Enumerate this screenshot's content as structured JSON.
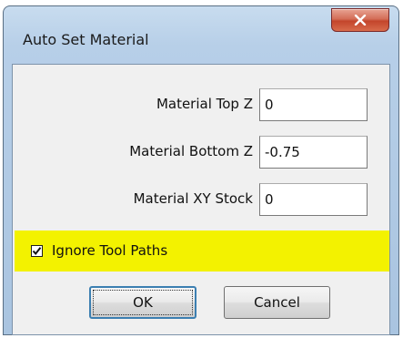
{
  "window": {
    "title": "Auto Set Material"
  },
  "fields": [
    {
      "label": "Material Top Z",
      "value": "0"
    },
    {
      "label": "Material Bottom Z",
      "value": "-0.75"
    },
    {
      "label": "Material XY Stock",
      "value": "0"
    }
  ],
  "ignore_tool_paths": {
    "label": "Ignore Tool Paths",
    "checked": true
  },
  "buttons": {
    "ok": "OK",
    "cancel": "Cancel"
  },
  "icons": {
    "close": "close-icon",
    "check": "check-icon"
  },
  "colors": {
    "highlight": "#f3f200",
    "close_button": "#c3452b",
    "window_frame": "#b7cfe8"
  }
}
